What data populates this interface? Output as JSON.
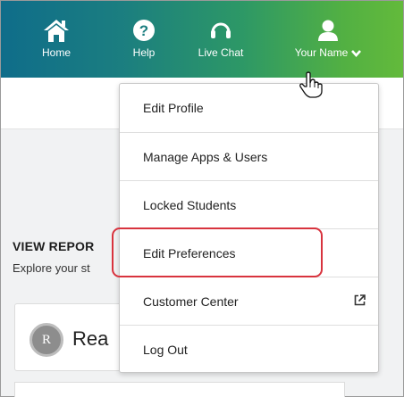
{
  "nav": {
    "home_label": "Home",
    "help_label": "Help",
    "chat_label": "Live Chat",
    "user_label": "Your Name"
  },
  "reports": {
    "title": "VIEW REPOR",
    "subtitle": "Explore your st",
    "card": {
      "avatar_letter": "R",
      "name": "Rea"
    }
  },
  "menu": {
    "items": [
      {
        "label": "Edit Profile"
      },
      {
        "label": "Manage Apps & Users"
      },
      {
        "label": "Locked Students"
      },
      {
        "label": "Edit Preferences"
      },
      {
        "label": "Customer Center"
      },
      {
        "label": "Log Out"
      }
    ]
  },
  "colors": {
    "nav_gradient_start": "#0f6d8a",
    "nav_gradient_end": "#63ba3b",
    "highlight": "#d8333e"
  }
}
